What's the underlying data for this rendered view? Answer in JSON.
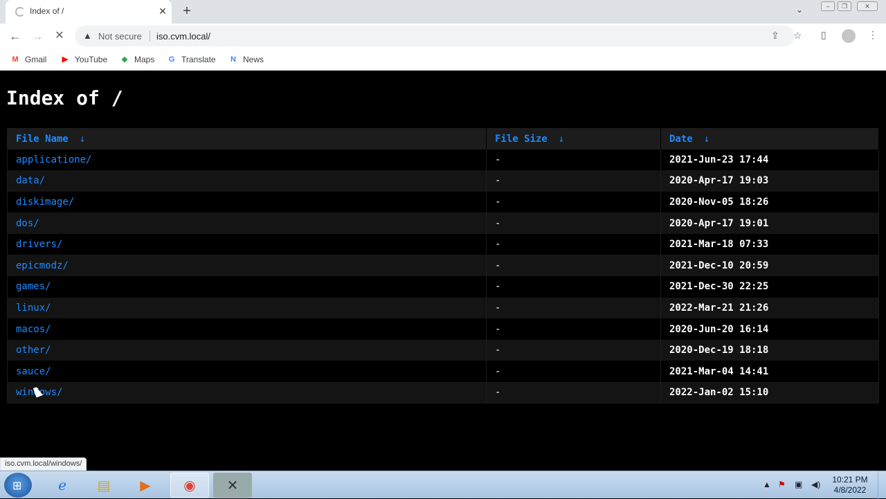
{
  "browser": {
    "tab_title": "Index of /",
    "tab_close": "✕",
    "new_tab": "+",
    "tab_search": "⌄",
    "back": "←",
    "forward": "→",
    "reload": "✕",
    "not_secure": "Not secure",
    "url": "iso.cvm.local/",
    "bookmarks": [
      {
        "label": "Gmail",
        "icon": "M",
        "color": "#ea4335"
      },
      {
        "label": "YouTube",
        "icon": "▶",
        "color": "#ff0000"
      },
      {
        "label": "Maps",
        "icon": "◆",
        "color": "#34a853"
      },
      {
        "label": "Translate",
        "icon": "G",
        "color": "#4285f4"
      },
      {
        "label": "News",
        "icon": "N",
        "color": "#4285f4"
      }
    ],
    "status_url": "iso.cvm.local/windows/"
  },
  "page": {
    "title": "Index of /",
    "columns": [
      {
        "label": "File Name",
        "arrow": "↓"
      },
      {
        "label": "File Size",
        "arrow": "↓"
      },
      {
        "label": "Date",
        "arrow": "↓"
      }
    ],
    "rows": [
      {
        "name": "applicatione/",
        "size": "-",
        "date": "2021-Jun-23 17:44"
      },
      {
        "name": "data/",
        "size": "-",
        "date": "2020-Apr-17 19:03"
      },
      {
        "name": "diskimage/",
        "size": "-",
        "date": "2020-Nov-05 18:26"
      },
      {
        "name": "dos/",
        "size": "-",
        "date": "2020-Apr-17 19:01"
      },
      {
        "name": "drivers/",
        "size": "-",
        "date": "2021-Mar-18 07:33"
      },
      {
        "name": "epicmodz/",
        "size": "-",
        "date": "2021-Dec-10 20:59"
      },
      {
        "name": "games/",
        "size": "-",
        "date": "2021-Dec-30 22:25"
      },
      {
        "name": "linux/",
        "size": "-",
        "date": "2022-Mar-21 21:26"
      },
      {
        "name": "macos/",
        "size": "-",
        "date": "2020-Jun-20 16:14"
      },
      {
        "name": "other/",
        "size": "-",
        "date": "2020-Dec-19 18:18"
      },
      {
        "name": "sauce/",
        "size": "-",
        "date": "2021-Mar-04 14:41"
      },
      {
        "name": "windows/",
        "size": "-",
        "date": "2022-Jan-02 15:10"
      }
    ]
  },
  "taskbar": {
    "time": "10:21 PM",
    "date": "4/8/2022"
  },
  "colors": {
    "link": "#1e8aff",
    "header_bg": "#1c1c1c",
    "page_bg": "#000000"
  }
}
